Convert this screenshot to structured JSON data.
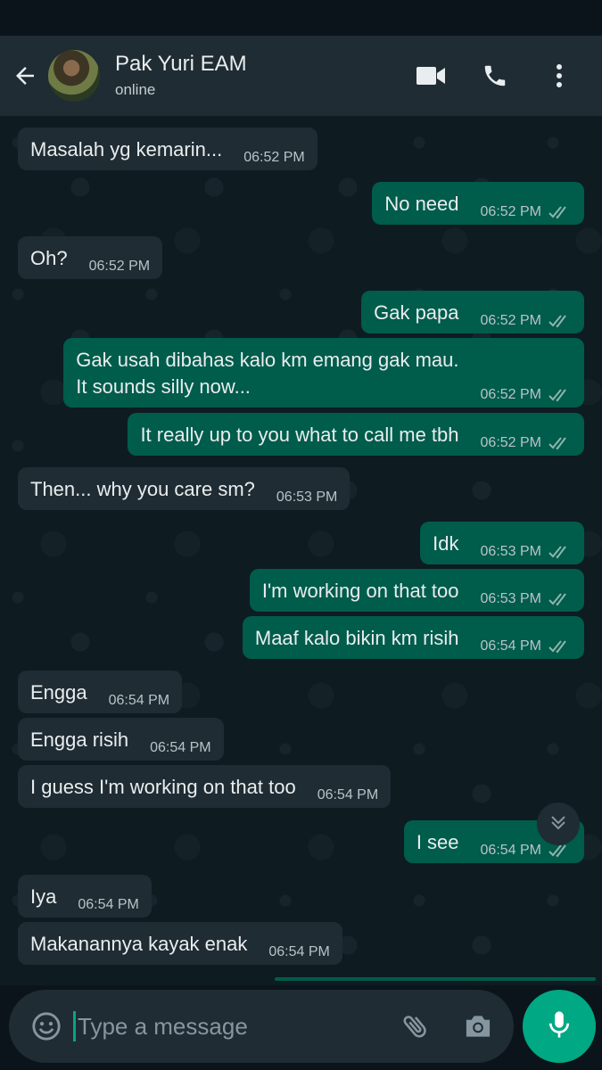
{
  "header": {
    "contact_name": "Pak Yuri EAM",
    "contact_status": "online",
    "icons": [
      "back-arrow-icon",
      "video-call-icon",
      "phone-icon",
      "more-options-icon"
    ]
  },
  "messages": [
    {
      "direction": "in",
      "text": "Masalah yg kemarin...",
      "time": "06:52 PM"
    },
    {
      "direction": "out",
      "text": "No need",
      "time": "06:52 PM",
      "status": "read"
    },
    {
      "direction": "in",
      "text": "Oh?",
      "time": "06:52 PM"
    },
    {
      "direction": "out",
      "text": "Gak papa",
      "time": "06:52 PM",
      "status": "read"
    },
    {
      "direction": "out",
      "text": "Gak usah dibahas kalo km emang gak mau.\nIt sounds silly now...",
      "time": "06:52 PM",
      "status": "read"
    },
    {
      "direction": "out",
      "text": "It really up to you what to call me tbh",
      "time": "06:52 PM",
      "status": "read"
    },
    {
      "direction": "in",
      "text": "Then... why you care sm?",
      "time": "06:53 PM"
    },
    {
      "direction": "out",
      "text": "Idk",
      "time": "06:53 PM",
      "status": "read"
    },
    {
      "direction": "out",
      "text": "I'm working on that too",
      "time": "06:53 PM",
      "status": "read"
    },
    {
      "direction": "out",
      "text": "Maaf kalo bikin km risih",
      "time": "06:54 PM",
      "status": "read"
    },
    {
      "direction": "in",
      "text": "Engga",
      "time": "06:54 PM"
    },
    {
      "direction": "in",
      "text": "Engga risih",
      "time": "06:54 PM"
    },
    {
      "direction": "in",
      "text": "I guess I'm working on that too",
      "time": "06:54 PM"
    },
    {
      "direction": "out",
      "text": "I see",
      "time": "06:54 PM",
      "status": "read"
    },
    {
      "direction": "in",
      "text": "Iya",
      "time": "06:54 PM"
    },
    {
      "direction": "in",
      "text": "Makanannya kayak enak",
      "time": "06:54 PM"
    }
  ],
  "composer": {
    "placeholder": "Type a message",
    "icons": [
      "emoji-icon",
      "attach-icon",
      "camera-icon",
      "mic-icon"
    ]
  },
  "colors": {
    "header_bg": "#1f2c33",
    "incoming_bubble": "#1f2c33",
    "outgoing_bubble": "#005c4b",
    "accent": "#00a884",
    "text": "#e9edef"
  }
}
